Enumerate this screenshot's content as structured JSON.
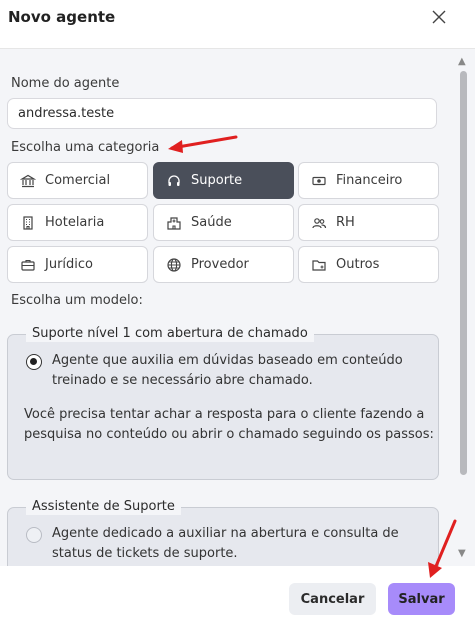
{
  "dialog": {
    "title": "Novo agente"
  },
  "form": {
    "name_label": "Nome do agente",
    "name_value": "andressa.teste",
    "category_label": "Escolha uma categoria",
    "model_label": "Escolha um modelo:"
  },
  "categories": [
    {
      "label": "Comercial",
      "icon": "bank-icon",
      "selected": false
    },
    {
      "label": "Suporte",
      "icon": "headset-icon",
      "selected": true
    },
    {
      "label": "Financeiro",
      "icon": "money-icon",
      "selected": false
    },
    {
      "label": "Hotelaria",
      "icon": "building-icon",
      "selected": false
    },
    {
      "label": "Saúde",
      "icon": "hospital-icon",
      "selected": false
    },
    {
      "label": "RH",
      "icon": "users-icon",
      "selected": false
    },
    {
      "label": "Jurídico",
      "icon": "briefcase-icon",
      "selected": false
    },
    {
      "label": "Provedor",
      "icon": "globe-icon",
      "selected": false
    },
    {
      "label": "Outros",
      "icon": "folder-icon",
      "selected": false
    }
  ],
  "models": [
    {
      "title": "Suporte nível 1 com abertura de chamado",
      "description": "Agente que auxilia em dúvidas baseado em conteúdo treinado e se necessário abre chamado.",
      "note": "Você precisa tentar achar a resposta para o cliente fazendo a pesquisa no conteúdo ou abrir o chamado seguindo os passos:",
      "selected": true
    },
    {
      "title": "Assistente de Suporte",
      "description": "Agente dedicado a auxiliar na abertura e consulta de status de tickets de suporte.",
      "selected": false
    }
  ],
  "footer": {
    "cancel_label": "Cancelar",
    "save_label": "Salvar"
  },
  "colors": {
    "accent_save": "#a78bfa",
    "selected_category": "#4a4f5a",
    "annotation_arrow": "#e02020"
  }
}
